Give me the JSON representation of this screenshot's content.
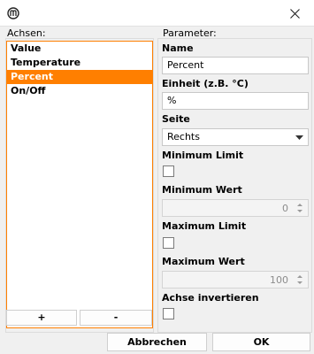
{
  "window": {
    "close_icon": "close-icon",
    "app_icon": "app-logo-icon"
  },
  "axes_panel": {
    "label": "Achsen:",
    "items": [
      {
        "label": "Value",
        "selected": false
      },
      {
        "label": "Temperature",
        "selected": false
      },
      {
        "label": "Percent",
        "selected": true
      },
      {
        "label": "On/Off",
        "selected": false
      }
    ],
    "add_label": "+",
    "remove_label": "-"
  },
  "params": {
    "label": "Parameter:",
    "name_label": "Name",
    "name_value": "Percent",
    "unit_label": "Einheit (z.B. °C)",
    "unit_value": "%",
    "side_label": "Seite",
    "side_value": "Rechts",
    "min_limit_label": "Minimum Limit",
    "min_value_label": "Minimum Wert",
    "min_value": "0",
    "max_limit_label": "Maximum Limit",
    "max_value_label": "Maximum Wert",
    "max_value": "100",
    "invert_label": "Achse invertieren"
  },
  "footer": {
    "cancel_label": "Abbrechen",
    "ok_label": "OK"
  },
  "colors": {
    "accent": "#ff7f00"
  }
}
